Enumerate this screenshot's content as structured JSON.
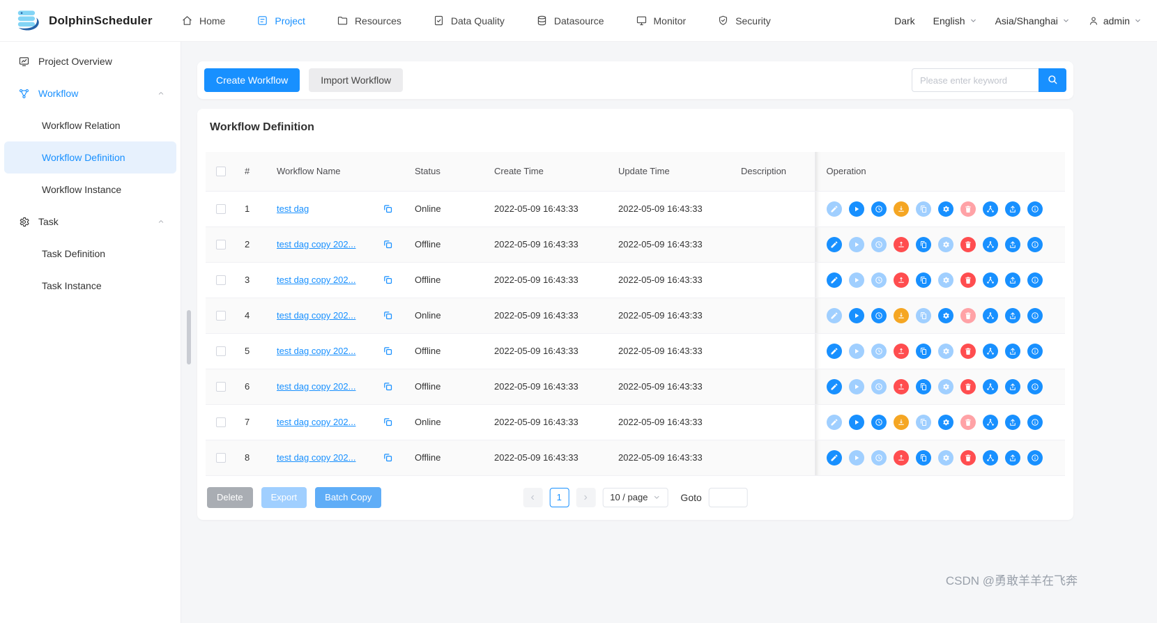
{
  "brand": {
    "name": "DolphinScheduler"
  },
  "nav": {
    "items": [
      {
        "id": "home",
        "label": "Home",
        "active": false
      },
      {
        "id": "project",
        "label": "Project",
        "active": true
      },
      {
        "id": "resources",
        "label": "Resources",
        "active": false
      },
      {
        "id": "data-quality",
        "label": "Data Quality",
        "active": false
      },
      {
        "id": "datasource",
        "label": "Datasource",
        "active": false
      },
      {
        "id": "monitor",
        "label": "Monitor",
        "active": false
      },
      {
        "id": "security",
        "label": "Security",
        "active": false
      }
    ],
    "theme_label": "Dark",
    "language": "English",
    "timezone": "Asia/Shanghai",
    "user": "admin"
  },
  "sidebar": {
    "items": [
      {
        "label": "Project Overview",
        "type": "item",
        "icon": "overview"
      },
      {
        "label": "Workflow",
        "type": "group",
        "icon": "workflow",
        "active": true,
        "expanded": true
      },
      {
        "label": "Workflow Relation",
        "type": "sub"
      },
      {
        "label": "Workflow Definition",
        "type": "sub",
        "selected": true
      },
      {
        "label": "Workflow Instance",
        "type": "sub"
      },
      {
        "label": "Task",
        "type": "group",
        "icon": "task",
        "active": false,
        "expanded": true
      },
      {
        "label": "Task Definition",
        "type": "sub"
      },
      {
        "label": "Task Instance",
        "type": "sub"
      }
    ]
  },
  "toolbar": {
    "create_button": "Create Workflow",
    "import_button": "Import Workflow",
    "search_placeholder": "Please enter keyword"
  },
  "panel": {
    "title": "Workflow Definition"
  },
  "table": {
    "columns": [
      {
        "key": "index",
        "label": "#"
      },
      {
        "key": "name",
        "label": "Workflow Name"
      },
      {
        "key": "status",
        "label": "Status"
      },
      {
        "key": "create_time",
        "label": "Create Time"
      },
      {
        "key": "update_time",
        "label": "Update Time"
      },
      {
        "key": "description",
        "label": "Description"
      },
      {
        "key": "operation",
        "label": "Operation"
      }
    ],
    "rows": [
      {
        "index": "1",
        "name": "test dag",
        "status": "Online",
        "create_time": "2022-05-09 16:43:33",
        "update_time": "2022-05-09 16:43:33",
        "description": ""
      },
      {
        "index": "2",
        "name": "test dag copy 202...",
        "status": "Offline",
        "create_time": "2022-05-09 16:43:33",
        "update_time": "2022-05-09 16:43:33",
        "description": ""
      },
      {
        "index": "3",
        "name": "test dag copy 202...",
        "status": "Offline",
        "create_time": "2022-05-09 16:43:33",
        "update_time": "2022-05-09 16:43:33",
        "description": ""
      },
      {
        "index": "4",
        "name": "test dag copy 202...",
        "status": "Online",
        "create_time": "2022-05-09 16:43:33",
        "update_time": "2022-05-09 16:43:33",
        "description": ""
      },
      {
        "index": "5",
        "name": "test dag copy 202...",
        "status": "Offline",
        "create_time": "2022-05-09 16:43:33",
        "update_time": "2022-05-09 16:43:33",
        "description": ""
      },
      {
        "index": "6",
        "name": "test dag copy 202...",
        "status": "Offline",
        "create_time": "2022-05-09 16:43:33",
        "update_time": "2022-05-09 16:43:33",
        "description": ""
      },
      {
        "index": "7",
        "name": "test dag copy 202...",
        "status": "Online",
        "create_time": "2022-05-09 16:43:33",
        "update_time": "2022-05-09 16:43:33",
        "description": ""
      },
      {
        "index": "8",
        "name": "test dag copy 202...",
        "status": "Offline",
        "create_time": "2022-05-09 16:43:33",
        "update_time": "2022-05-09 16:43:33",
        "description": ""
      }
    ],
    "operations": [
      {
        "name": "edit",
        "title": "Edit",
        "disabled_for": "Online"
      },
      {
        "name": "start",
        "title": "Start",
        "disabled_for": "Offline"
      },
      {
        "name": "timing",
        "title": "Timing",
        "disabled_for": "Offline"
      },
      {
        "name": "release",
        "title": "Online/Offline"
      },
      {
        "name": "copy",
        "title": "Copy Workflow",
        "disabled_for": "Online"
      },
      {
        "name": "cron",
        "title": "Cron Manage",
        "disabled_for": "Offline"
      },
      {
        "name": "delete",
        "title": "Delete",
        "disabled_for": "Online"
      },
      {
        "name": "tree",
        "title": "Tree View"
      },
      {
        "name": "export",
        "title": "Export"
      },
      {
        "name": "version",
        "title": "Version Info"
      }
    ]
  },
  "footer": {
    "delete_button": "Delete",
    "export_button": "Export",
    "batch_copy_button": "Batch Copy",
    "pagination": {
      "current": "1",
      "page_size": "10 / page",
      "goto_label": "Goto"
    }
  },
  "watermark": "CSDN @勇敢羊羊在飞奔",
  "colors": {
    "primary": "#1890ff",
    "primary_disabled": "#a0cfff",
    "warning": "#f5a623",
    "danger": "#ff4d4f",
    "danger_disabled": "#ffa2a6"
  }
}
